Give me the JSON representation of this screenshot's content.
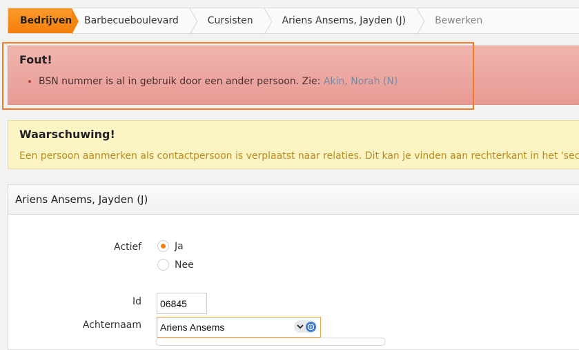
{
  "breadcrumb": {
    "items": [
      "Bedrijven",
      "Barbecueboulevard",
      "Cursisten",
      "Ariens Ansems, Jayden (J)",
      "Bewerken"
    ]
  },
  "error": {
    "title": "Fout!",
    "message": "BSN nummer is al in gebruik door een ander persoon. Zie: ",
    "link": "Akin, Norah (N)"
  },
  "warning": {
    "title": "Waarschuwing!",
    "message": "Een persoon aanmerken als contactpersoon is verplaatst naar relaties. Dit kan je vinden aan rechterkant in het 'secties' me"
  },
  "form": {
    "title": "Ariens Ansems, Jayden (J)",
    "actief_label": "Actief",
    "actief_options": [
      "Ja",
      "Nee"
    ],
    "actief_selected": "Ja",
    "id_label": "Id",
    "id_value": "06845",
    "achternaam_label": "Achternaam",
    "achternaam_value": "Ariens Ansems"
  },
  "colors": {
    "accent": "#f47f0c",
    "error_bg": "#eba59e",
    "warning_bg": "#fdf4c3",
    "warning_text": "#b98a1e",
    "link": "#7a89a1"
  }
}
